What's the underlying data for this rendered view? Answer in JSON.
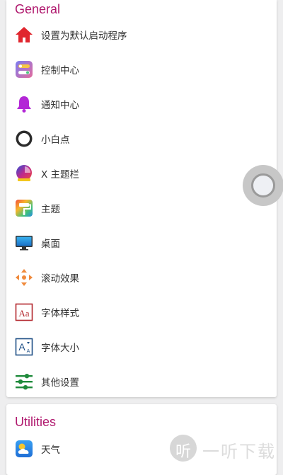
{
  "sections": {
    "general": {
      "title": "General",
      "items": [
        {
          "label": "设置为默认启动程序",
          "icon": "home-icon"
        },
        {
          "label": "控制中心",
          "icon": "control-center-icon"
        },
        {
          "label": "通知中心",
          "icon": "bell-icon"
        },
        {
          "label": "小白点",
          "icon": "white-dot-icon"
        },
        {
          "label": "X 主题栏",
          "icon": "theme-bar-icon"
        },
        {
          "label": "主题",
          "icon": "paint-roller-icon"
        },
        {
          "label": "桌面",
          "icon": "monitor-icon"
        },
        {
          "label": "滚动效果",
          "icon": "scroll-arrows-icon"
        },
        {
          "label": "字体样式",
          "icon": "font-style-icon"
        },
        {
          "label": "字体大小",
          "icon": "font-size-icon"
        },
        {
          "label": "其他设置",
          "icon": "sliders-icon"
        }
      ]
    },
    "utilities": {
      "title": "Utilities",
      "items": [
        {
          "label": "天气",
          "icon": "weather-icon"
        }
      ]
    }
  },
  "floating_button": {
    "icon": "assistive-touch-icon"
  },
  "watermark": {
    "text": "一听下载",
    "logo_char": "听"
  },
  "colors": {
    "section_title": "#b0196e",
    "background": "#eeeeef",
    "card": "#ffffff"
  }
}
